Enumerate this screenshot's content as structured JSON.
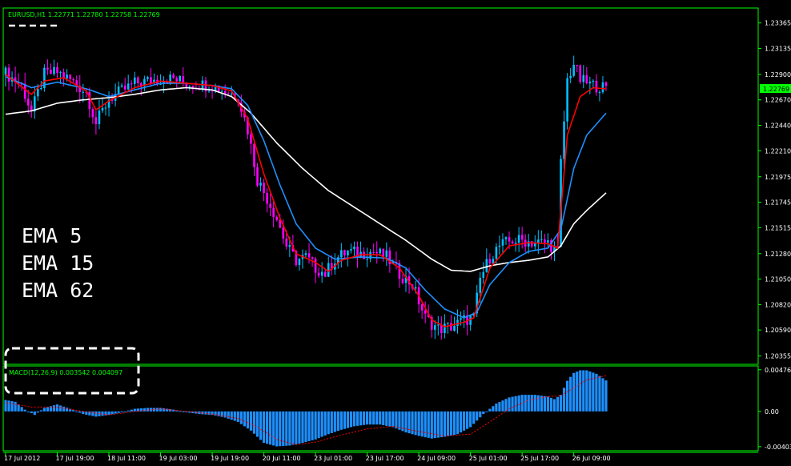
{
  "colors": {
    "background": "#000000",
    "frame": "#00ff00",
    "bull_candle": "#00bfff",
    "bear_candle": "#ff00ff",
    "ema5": "#ff0000",
    "ema15": "#1e90ff",
    "ema62": "#ffffff",
    "macd_hist": "#1e90ff",
    "macd_signal": "#ff0000",
    "axis_text": "#ffffff",
    "header_text": "#00ff00",
    "current_price_box": "#00ff00",
    "annotation": "#ffffff"
  },
  "chart_data": [
    {
      "type": "candlestick",
      "title": "EURUSD,H1  1.22771 1.22780 1.22758 1.22769",
      "symbol": "EURUSD",
      "timeframe": "H1",
      "ohlc_last": {
        "open": 1.22771,
        "high": 1.2278,
        "low": 1.22758,
        "close": 1.22769
      },
      "current_price": "1.22769",
      "ylim": [
        1.2028,
        1.235
      ],
      "yticks": [
        "1.23365",
        "1.23135",
        "1.22900",
        "1.22670",
        "1.22440",
        "1.22210",
        "1.21975",
        "1.21745",
        "1.21515",
        "1.21280",
        "1.21050",
        "1.20820",
        "1.20590",
        "1.20355"
      ],
      "yticks_values": [
        1.23365,
        1.23135,
        1.229,
        1.2267,
        1.2244,
        1.2221,
        1.21975,
        1.21745,
        1.21515,
        1.2128,
        1.2105,
        1.2082,
        1.2059,
        1.20355
      ],
      "xticks": [
        "17 Jul 2012",
        "17 Jul 19:00",
        "18 Jul 11:00",
        "19 Jul 03:00",
        "19 Jul 19:00",
        "20 Jul 11:00",
        "23 Jul 01:00",
        "23 Jul 17:00",
        "24 Jul 09:00",
        "25 Jul 01:00",
        "25 Jul 17:00",
        "26 Jul 09:00"
      ],
      "xticks_bar_index": [
        0,
        16,
        32,
        48,
        64,
        80,
        96,
        112,
        128,
        144,
        160,
        176
      ],
      "bar_count": 187,
      "annotations": [
        "EMA 5",
        "EMA 15",
        "EMA 62"
      ],
      "close_anchors": [
        [
          0,
          1.2291
        ],
        [
          5,
          1.228
        ],
        [
          8,
          1.2256
        ],
        [
          12,
          1.229
        ],
        [
          16,
          1.2292
        ],
        [
          20,
          1.2285
        ],
        [
          25,
          1.2274
        ],
        [
          28,
          1.2246
        ],
        [
          32,
          1.2268
        ],
        [
          36,
          1.2275
        ],
        [
          40,
          1.2282
        ],
        [
          44,
          1.2284
        ],
        [
          48,
          1.2286
        ],
        [
          52,
          1.2286
        ],
        [
          56,
          1.2282
        ],
        [
          60,
          1.2281
        ],
        [
          64,
          1.228
        ],
        [
          68,
          1.2275
        ],
        [
          72,
          1.227
        ],
        [
          75,
          1.224
        ],
        [
          78,
          1.2195
        ],
        [
          81,
          1.2178
        ],
        [
          84,
          1.216
        ],
        [
          87,
          1.2135
        ],
        [
          90,
          1.2122
        ],
        [
          93,
          1.2125
        ],
        [
          96,
          1.2115
        ],
        [
          99,
          1.211
        ],
        [
          102,
          1.2123
        ],
        [
          106,
          1.213
        ],
        [
          110,
          1.2128
        ],
        [
          114,
          1.213
        ],
        [
          118,
          1.2125
        ],
        [
          122,
          1.211
        ],
        [
          126,
          1.21
        ],
        [
          130,
          1.207
        ],
        [
          134,
          1.206
        ],
        [
          138,
          1.2062
        ],
        [
          142,
          1.2068
        ],
        [
          145,
          1.207
        ],
        [
          147,
          1.2105
        ],
        [
          150,
          1.2125
        ],
        [
          153,
          1.2135
        ],
        [
          157,
          1.214
        ],
        [
          160,
          1.214
        ],
        [
          164,
          1.2138
        ],
        [
          168,
          1.2138
        ],
        [
          171,
          1.213
        ],
        [
          172,
          1.221
        ],
        [
          174,
          1.2285
        ],
        [
          176,
          1.23
        ],
        [
          178,
          1.2285
        ],
        [
          181,
          1.2281
        ],
        [
          184,
          1.2279
        ],
        [
          186,
          1.22769
        ]
      ],
      "ema_anchors": {
        "ema5": [
          [
            0,
            1.229
          ],
          [
            8,
            1.2272
          ],
          [
            12,
            1.2284
          ],
          [
            18,
            1.2287
          ],
          [
            25,
            1.2275
          ],
          [
            28,
            1.2258
          ],
          [
            32,
            1.2266
          ],
          [
            40,
            1.2278
          ],
          [
            48,
            1.2284
          ],
          [
            56,
            1.2282
          ],
          [
            64,
            1.228
          ],
          [
            70,
            1.2275
          ],
          [
            75,
            1.225
          ],
          [
            80,
            1.22
          ],
          [
            85,
            1.216
          ],
          [
            90,
            1.2128
          ],
          [
            96,
            1.212
          ],
          [
            100,
            1.2112
          ],
          [
            104,
            1.2122
          ],
          [
            110,
            1.2127
          ],
          [
            116,
            1.2127
          ],
          [
            122,
            1.2115
          ],
          [
            128,
            1.209
          ],
          [
            132,
            1.2068
          ],
          [
            136,
            1.2062
          ],
          [
            142,
            1.2066
          ],
          [
            145,
            1.207
          ],
          [
            150,
            1.2115
          ],
          [
            156,
            1.2135
          ],
          [
            162,
            1.2138
          ],
          [
            168,
            1.2137
          ],
          [
            171,
            1.2133
          ],
          [
            174,
            1.2235
          ],
          [
            178,
            1.227
          ],
          [
            182,
            1.2278
          ],
          [
            186,
            1.22769
          ]
        ],
        "ema15": [
          [
            0,
            1.2288
          ],
          [
            8,
            1.2278
          ],
          [
            16,
            1.2283
          ],
          [
            25,
            1.2277
          ],
          [
            32,
            1.227
          ],
          [
            40,
            1.2276
          ],
          [
            48,
            1.2282
          ],
          [
            56,
            1.2282
          ],
          [
            64,
            1.228
          ],
          [
            70,
            1.2277
          ],
          [
            75,
            1.2262
          ],
          [
            80,
            1.223
          ],
          [
            85,
            1.219
          ],
          [
            90,
            1.2155
          ],
          [
            96,
            1.2133
          ],
          [
            102,
            1.2123
          ],
          [
            110,
            1.2125
          ],
          [
            118,
            1.2124
          ],
          [
            124,
            1.2115
          ],
          [
            130,
            1.2095
          ],
          [
            136,
            1.2078
          ],
          [
            142,
            1.207
          ],
          [
            146,
            1.2075
          ],
          [
            150,
            1.21
          ],
          [
            156,
            1.212
          ],
          [
            162,
            1.213
          ],
          [
            168,
            1.2133
          ],
          [
            172,
            1.215
          ],
          [
            176,
            1.2205
          ],
          [
            180,
            1.2235
          ],
          [
            186,
            1.2255
          ]
        ],
        "ema62": [
          [
            0,
            1.2254
          ],
          [
            8,
            1.2257
          ],
          [
            16,
            1.2264
          ],
          [
            24,
            1.2267
          ],
          [
            32,
            1.2269
          ],
          [
            40,
            1.2272
          ],
          [
            48,
            1.2276
          ],
          [
            56,
            1.2278
          ],
          [
            64,
            1.2276
          ],
          [
            70,
            1.227
          ],
          [
            76,
            1.2255
          ],
          [
            84,
            1.2228
          ],
          [
            92,
            1.2205
          ],
          [
            100,
            1.2185
          ],
          [
            108,
            1.217
          ],
          [
            116,
            1.2155
          ],
          [
            124,
            1.214
          ],
          [
            132,
            1.2123
          ],
          [
            138,
            1.2113
          ],
          [
            144,
            1.2112
          ],
          [
            150,
            1.2117
          ],
          [
            156,
            1.212
          ],
          [
            162,
            1.2122
          ],
          [
            168,
            1.2125
          ],
          [
            172,
            1.2135
          ],
          [
            176,
            1.2155
          ],
          [
            180,
            1.2167
          ],
          [
            186,
            1.2183
          ]
        ]
      }
    },
    {
      "type": "histogram",
      "title": "MACD(12,26,9) 0.003542 0.004097",
      "indicator": "MACD",
      "params": [
        12,
        26,
        9
      ],
      "macd_value": 0.003542,
      "signal_value": 0.004097,
      "ylim": [
        -0.0045,
        0.0052
      ],
      "yticks": [
        "0.004763",
        "0.00",
        "-0.00403"
      ],
      "yticks_values": [
        0.004763,
        0.0,
        -0.00403
      ],
      "macd_anchors": [
        [
          0,
          0.0013
        ],
        [
          3,
          0.0011
        ],
        [
          6,
          0.0002
        ],
        [
          9,
          -0.0004
        ],
        [
          12,
          0.0004
        ],
        [
          16,
          0.0008
        ],
        [
          20,
          0.0003
        ],
        [
          24,
          -0.0003
        ],
        [
          28,
          -0.0006
        ],
        [
          32,
          -0.0004
        ],
        [
          36,
          -0.0001
        ],
        [
          40,
          0.0003
        ],
        [
          44,
          0.0004
        ],
        [
          48,
          0.0004
        ],
        [
          52,
          0.0002
        ],
        [
          56,
          -0.0001
        ],
        [
          60,
          -0.0003
        ],
        [
          64,
          -0.0004
        ],
        [
          68,
          -0.0007
        ],
        [
          72,
          -0.0012
        ],
        [
          76,
          -0.0022
        ],
        [
          80,
          -0.0036
        ],
        [
          84,
          -0.004
        ],
        [
          88,
          -0.0039
        ],
        [
          92,
          -0.0036
        ],
        [
          96,
          -0.0032
        ],
        [
          100,
          -0.0026
        ],
        [
          104,
          -0.0021
        ],
        [
          108,
          -0.0017
        ],
        [
          112,
          -0.0015
        ],
        [
          116,
          -0.0015
        ],
        [
          120,
          -0.0018
        ],
        [
          124,
          -0.0024
        ],
        [
          128,
          -0.0028
        ],
        [
          132,
          -0.0031
        ],
        [
          136,
          -0.0029
        ],
        [
          140,
          -0.0026
        ],
        [
          144,
          -0.0018
        ],
        [
          148,
          -0.0003
        ],
        [
          152,
          0.0009
        ],
        [
          156,
          0.0016
        ],
        [
          160,
          0.0019
        ],
        [
          164,
          0.0019
        ],
        [
          168,
          0.0017
        ],
        [
          170,
          0.0014
        ],
        [
          172,
          0.0019
        ],
        [
          174,
          0.0035
        ],
        [
          176,
          0.0044
        ],
        [
          178,
          0.0047
        ],
        [
          180,
          0.0047
        ],
        [
          183,
          0.0043
        ],
        [
          186,
          0.003542
        ]
      ],
      "signal_anchors": [
        [
          0,
          0.001
        ],
        [
          8,
          0.0005
        ],
        [
          16,
          0.0005
        ],
        [
          24,
          0.0
        ],
        [
          32,
          -0.0004
        ],
        [
          40,
          0.0
        ],
        [
          48,
          0.0003
        ],
        [
          56,
          0.0
        ],
        [
          64,
          -0.0003
        ],
        [
          72,
          -0.0008
        ],
        [
          78,
          -0.0018
        ],
        [
          84,
          -0.0032
        ],
        [
          90,
          -0.0038
        ],
        [
          96,
          -0.0035
        ],
        [
          104,
          -0.0027
        ],
        [
          112,
          -0.002
        ],
        [
          120,
          -0.0017
        ],
        [
          128,
          -0.0023
        ],
        [
          136,
          -0.0028
        ],
        [
          144,
          -0.0026
        ],
        [
          150,
          -0.0012
        ],
        [
          156,
          0.0003
        ],
        [
          162,
          0.0013
        ],
        [
          168,
          0.0017
        ],
        [
          172,
          0.0018
        ],
        [
          176,
          0.0027
        ],
        [
          180,
          0.0036
        ],
        [
          186,
          0.004097
        ]
      ]
    }
  ]
}
